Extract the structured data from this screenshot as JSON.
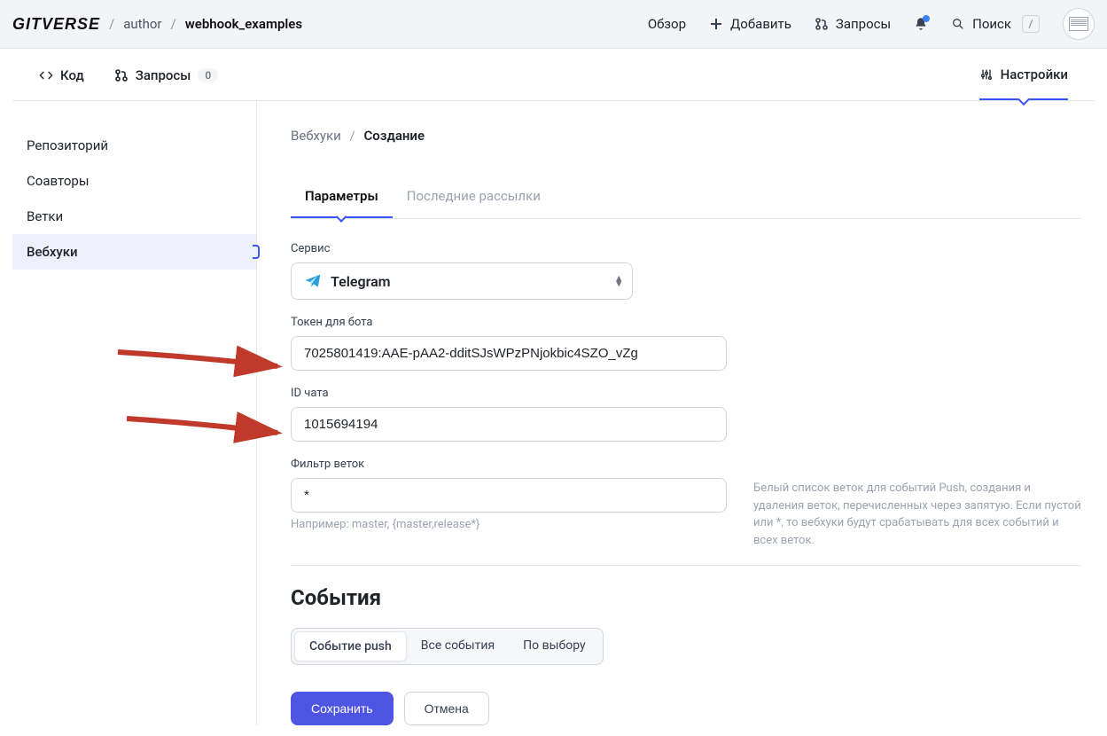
{
  "header": {
    "logo": "GITVERSE",
    "crumbs": {
      "author": "author",
      "repo": "webhook_examples"
    },
    "nav": {
      "overview": "Обзор",
      "add": "Добавить",
      "requests": "Запросы",
      "search": "Поиск",
      "search_key": "/"
    }
  },
  "repo_tabs": {
    "code": "Код",
    "requests": "Запросы",
    "requests_count": "0",
    "settings": "Настройки"
  },
  "sidebar": {
    "items": [
      "Репозиторий",
      "Соавторы",
      "Ветки",
      "Вебхуки"
    ],
    "active_index": 3
  },
  "breadcrumb": {
    "webhooks": "Вебхуки",
    "create": "Создание"
  },
  "inner_tabs": {
    "params": "Параметры",
    "recent": "Последние рассылки"
  },
  "form": {
    "service_label": "Сервис",
    "service_value": "Telegram",
    "token_label": "Токен для бота",
    "token_value": "7025801419:AAE-pAA2-dditSJsWPzPNjokbic4SZO_vZg",
    "chat_label": "ID чата",
    "chat_value": "1015694194",
    "filter_label": "Фильтр веток",
    "filter_value": "*",
    "filter_example": "Например: master, {master,release*}",
    "filter_help": "Белый список веток для событий Push, создания и удаления веток, перечисленных через запятую. Если пустой или *, то вебхуки будут срабатывать для всех событий и всех веток."
  },
  "events": {
    "title": "События",
    "options": [
      "Событие push",
      "Все события",
      "По выбору"
    ],
    "active": 0
  },
  "buttons": {
    "save": "Сохранить",
    "cancel": "Отмена"
  }
}
